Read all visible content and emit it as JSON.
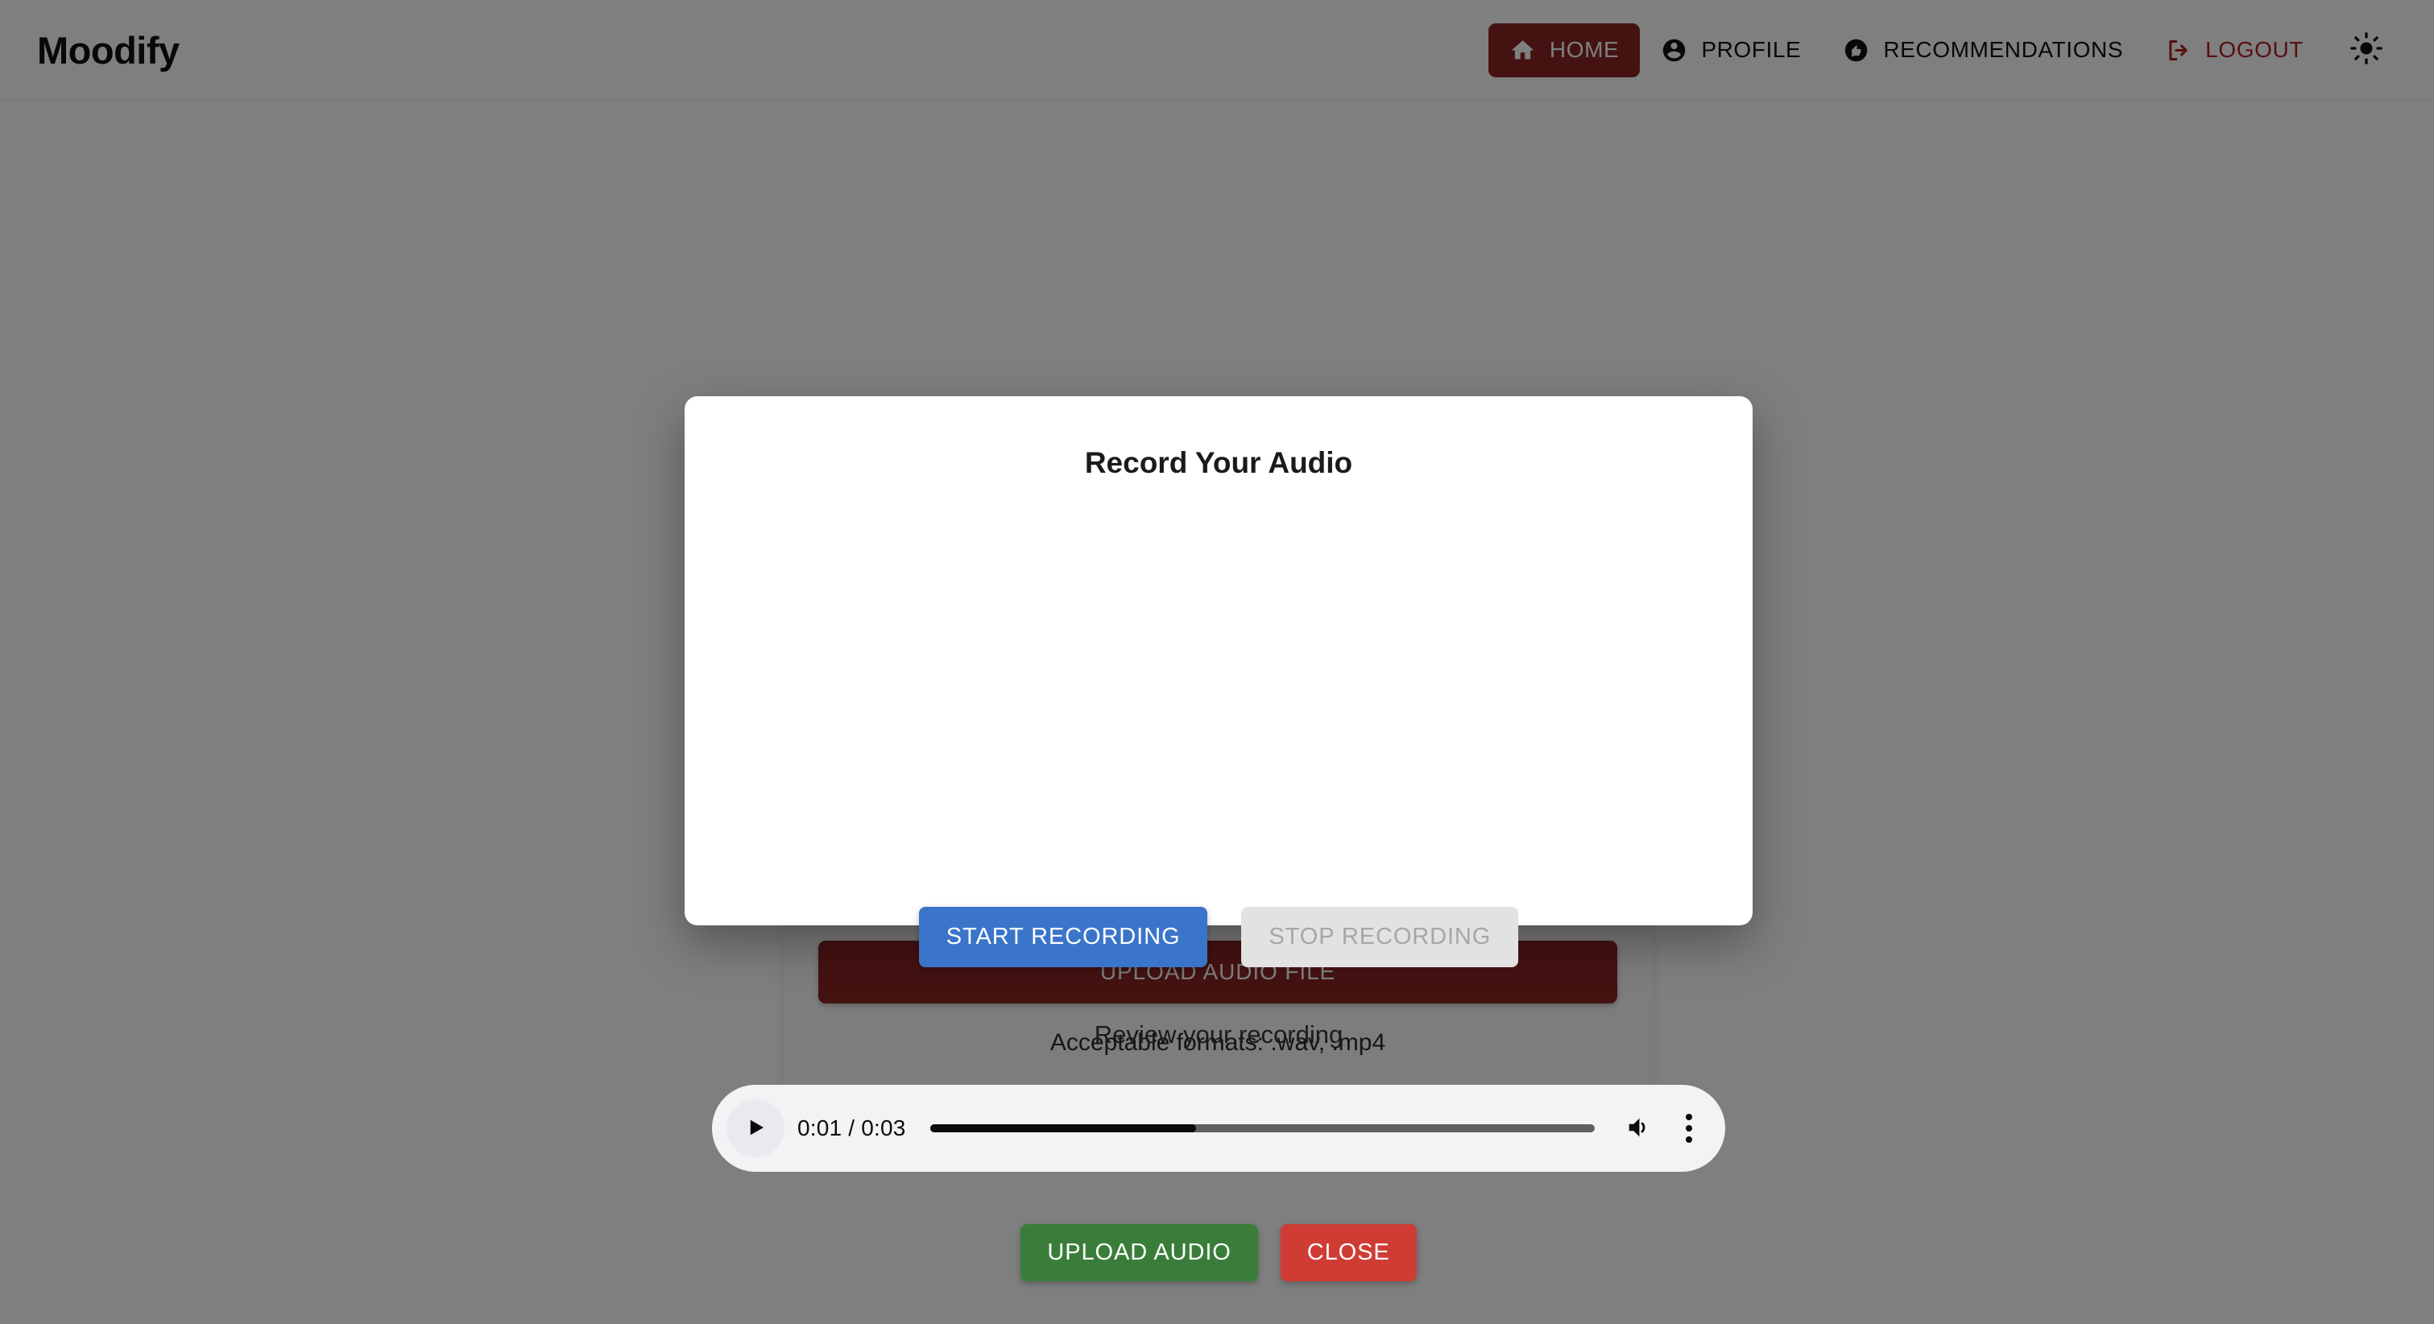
{
  "app": {
    "brand": "Moodify"
  },
  "nav": {
    "items": [
      {
        "label": "HOME",
        "icon": "home-icon",
        "active": true
      },
      {
        "label": "PROFILE",
        "icon": "account-circle-icon",
        "active": false
      },
      {
        "label": "RECOMMENDATIONS",
        "icon": "thumb-up-circle-icon",
        "active": false
      },
      {
        "label": "LOGOUT",
        "icon": "logout-icon",
        "active": false
      }
    ],
    "theme_toggle_icon": "sun-icon",
    "active_bg": "#8b2525",
    "logout_color": "#b32020"
  },
  "page": {
    "upload_file_button": "UPLOAD AUDIO FILE",
    "formats_note": "Acceptable formats: .wav, .mp4",
    "upload_button_color": "#8b2525"
  },
  "modal": {
    "title": "Record Your Audio",
    "start_recording": "START RECORDING",
    "stop_recording": "STOP RECORDING",
    "start_color": "#3a75ca",
    "stop_color": "#e2e2e2",
    "review_label": "Review your recording",
    "upload_audio": "UPLOAD AUDIO",
    "close": "CLOSE",
    "upload_color": "#3a7d3a",
    "close_color": "#cf3c34"
  },
  "audio_player": {
    "time": "0:01 / 0:03",
    "current_time": "0:01",
    "duration": "0:03",
    "progress_percent": 40,
    "play_icon": "play-icon",
    "volume_icon": "volume-up-icon",
    "menu_icon": "more-vertical-icon"
  }
}
